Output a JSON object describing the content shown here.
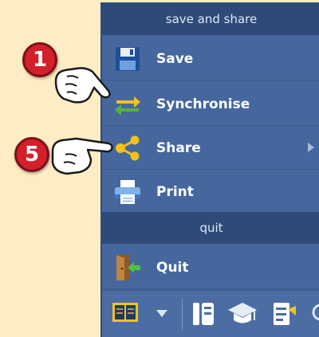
{
  "menu": {
    "section_save_share": "save and share",
    "items": [
      {
        "label": "Save",
        "icon": "floppy-disk-icon"
      },
      {
        "label": "Synchronise",
        "icon": "sync-arrows-icon"
      },
      {
        "label": "Share",
        "icon": "share-icon"
      },
      {
        "label": "Print",
        "icon": "printer-icon"
      }
    ],
    "section_quit": "quit",
    "quit": {
      "label": "Quit",
      "icon": "exit-door-icon"
    }
  },
  "toolbar": {
    "icons": [
      "book-icon",
      "dropdown-arrow-icon",
      "columns-icon",
      "graduation-cap-icon",
      "note-edit-icon"
    ]
  },
  "badges": {
    "step1": "1",
    "step5": "5"
  },
  "colors": {
    "menu_bg": "#46679e",
    "section_bg": "#2e4a79",
    "page_bg": "#fcebc0",
    "badge": "#d4202a"
  }
}
